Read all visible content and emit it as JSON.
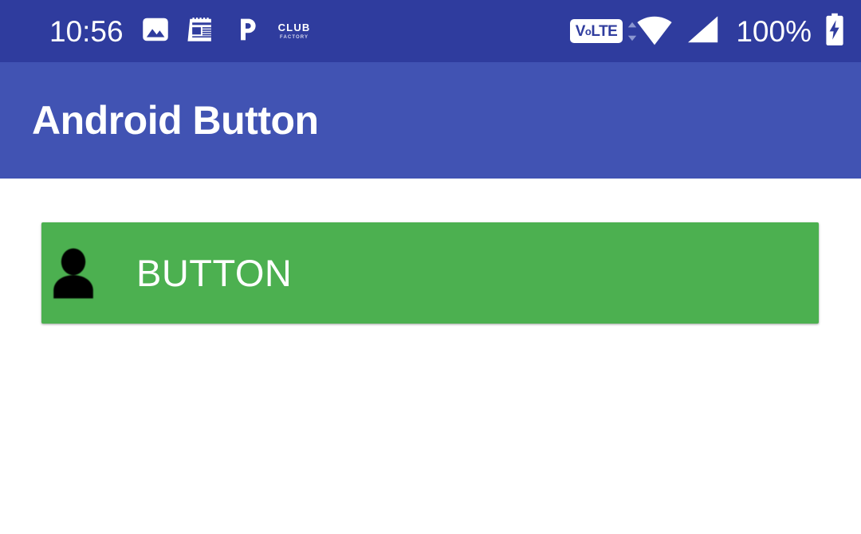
{
  "status_bar": {
    "clock": "10:56",
    "battery_percent": "100%",
    "volte_label": "VoLTE",
    "volte_prefix": "V",
    "volte_o": "o",
    "volte_suffix": "LTE",
    "club_factory_top": "CLUB",
    "club_factory_bottom": "FACTORY",
    "icons": [
      "gallery-icon",
      "news-icon",
      "phonepe-icon",
      "club-factory-icon",
      "volte-icon",
      "wifi-icon",
      "cellular-signal-icon",
      "battery-charging-icon"
    ],
    "colors": {
      "background": "#2f3c9e",
      "foreground": "#ffffff"
    }
  },
  "app_bar": {
    "title": "Android Button",
    "colors": {
      "background": "#4153b3",
      "title": "#ffffff"
    }
  },
  "content": {
    "button": {
      "label": "BUTTON",
      "icon": "account-person-icon",
      "colors": {
        "background": "#4cb050",
        "label": "#ffffff",
        "icon": "#000000"
      }
    },
    "colors": {
      "background": "#ffffff"
    }
  }
}
